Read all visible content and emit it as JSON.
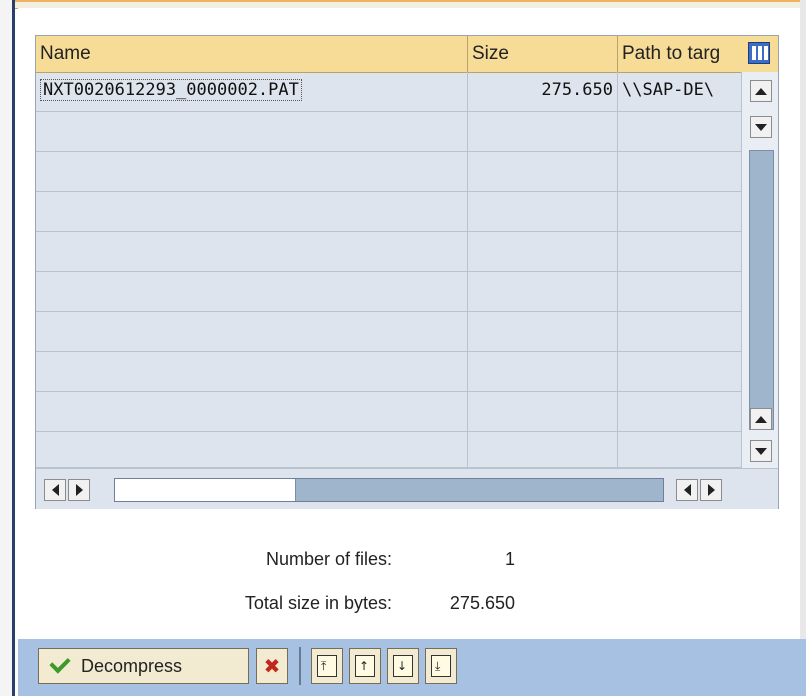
{
  "table": {
    "columns": [
      "Name",
      "Size",
      "Path to targ"
    ],
    "rows": [
      {
        "name": "NXT0020612293_0000002.PAT",
        "size": "275.650",
        "path": "\\\\SAP-DE\\"
      },
      {
        "name": "",
        "size": "",
        "path": ""
      },
      {
        "name": "",
        "size": "",
        "path": ""
      },
      {
        "name": "",
        "size": "",
        "path": ""
      },
      {
        "name": "",
        "size": "",
        "path": ""
      },
      {
        "name": "",
        "size": "",
        "path": ""
      },
      {
        "name": "",
        "size": "",
        "path": ""
      },
      {
        "name": "",
        "size": "",
        "path": ""
      },
      {
        "name": "",
        "size": "",
        "path": ""
      },
      {
        "name": "",
        "size": "",
        "path": ""
      }
    ]
  },
  "summary": {
    "files_label": "Number of files:",
    "files_value": "1",
    "bytes_label": "Total size in bytes:",
    "bytes_value": "275.650"
  },
  "toolbar": {
    "decompress_label": "Decompress",
    "cancel_glyph": "✖"
  },
  "icons": {
    "column-config": "column-layout-icon",
    "confirm": "checkmark-icon",
    "cancel": "cancel-x-icon",
    "nav": [
      "first-page-icon",
      "previous-page-icon",
      "next-page-icon",
      "last-page-icon"
    ]
  },
  "colors": {
    "header_bg": "#f6dc96",
    "grid_bg": "#dde4ee",
    "toolbar_bg": "#a7c1e3",
    "scroll_track": "#9fb5cc",
    "cancel_red": "#c0281c",
    "confirm_green": "#3b9a2a"
  }
}
